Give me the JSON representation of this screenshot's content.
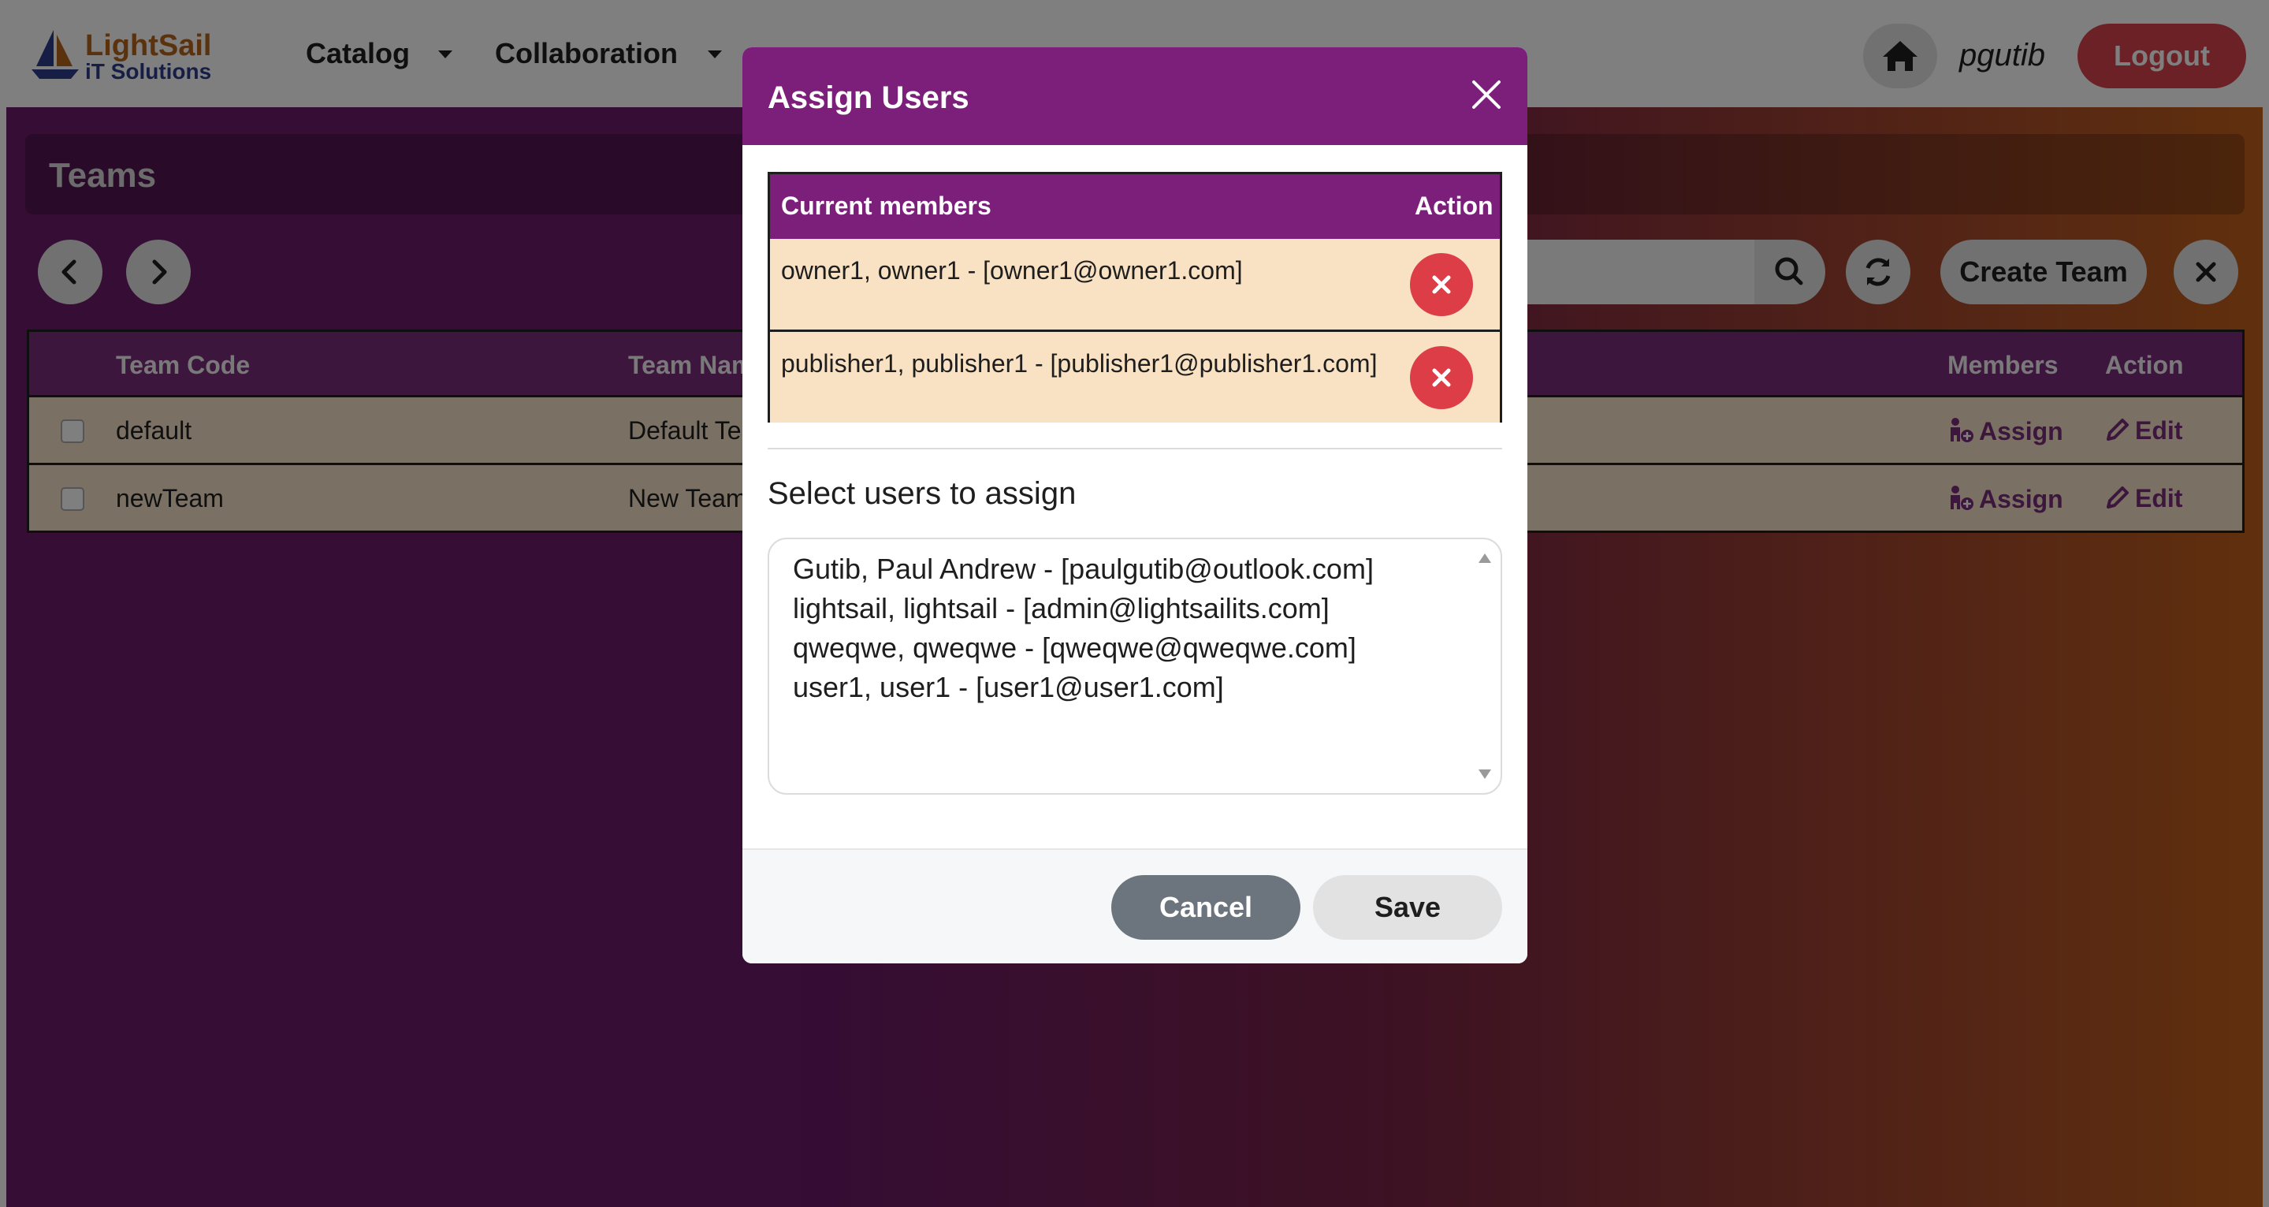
{
  "navbar": {
    "logo_line1": "LightSail",
    "logo_line2": "iT Solutions",
    "menu": [
      {
        "label": "Catalog"
      },
      {
        "label": "Collaboration"
      }
    ],
    "username": "pgutib",
    "logout_label": "Logout"
  },
  "teams": {
    "title": "Teams",
    "create_label": "Create Team",
    "columns": {
      "code": "Team Code",
      "name": "Team Name",
      "members": "Members",
      "action": "Action"
    },
    "rows": [
      {
        "code": "default",
        "name": "Default Team",
        "assign": "Assign",
        "edit": "Edit"
      },
      {
        "code": "newTeam",
        "name": "New Team",
        "assign": "Assign",
        "edit": "Edit"
      }
    ]
  },
  "modal": {
    "title": "Assign Users",
    "members_header": "Current members",
    "action_header": "Action",
    "current_members": [
      "owner1, owner1 - [owner1@owner1.com]",
      "publisher1, publisher1 - [publisher1@publisher1.com]"
    ],
    "select_title": "Select users to assign",
    "options": [
      "Gutib, Paul Andrew - [paulgutib@outlook.com]",
      "lightsail, lightsail - [admin@lightsailits.com]",
      "qweqwe, qweqwe - [qweqwe@qweqwe.com]",
      "user1, user1 - [user1@user1.com]"
    ],
    "cancel_label": "Cancel",
    "save_label": "Save"
  },
  "colors": {
    "brand_purple": "#7b1f7b",
    "danger_red": "#dc3d46",
    "row_beige": "#f8e2c3"
  },
  "icons": [
    "home-icon",
    "chevron-left-icon",
    "chevron-right-icon",
    "search-icon",
    "refresh-icon",
    "close-icon",
    "user-plus-icon",
    "pencil-icon",
    "x-icon",
    "caret-down-icon"
  ]
}
